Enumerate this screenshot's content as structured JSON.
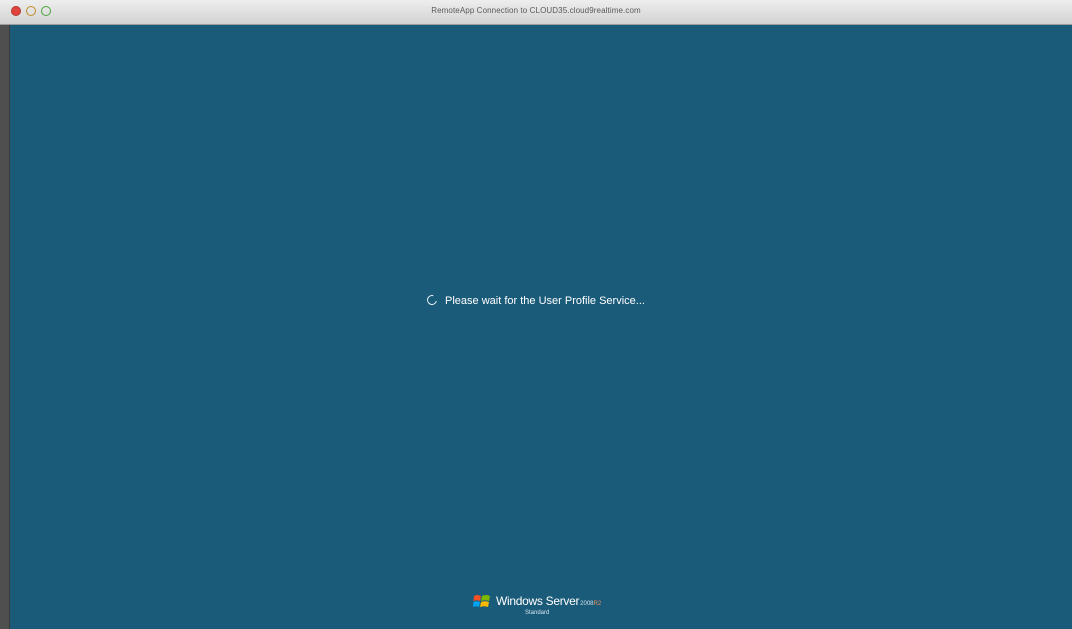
{
  "window": {
    "title": "RemoteApp Connection to CLOUD35.cloud9realtime.com"
  },
  "status": {
    "message": "Please wait for the User Profile Service..."
  },
  "branding": {
    "product": "Windows Server",
    "version": "2008",
    "release": "R2",
    "edition": "Standard"
  },
  "icons": {
    "spinner": "loading-spinner-icon",
    "logo": "windows-flag-logo-icon"
  },
  "colors": {
    "background": "#1a5b7a",
    "text": "#ffffff"
  }
}
